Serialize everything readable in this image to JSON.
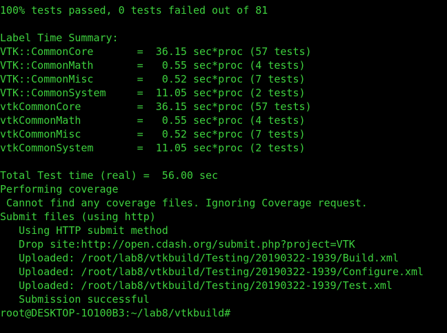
{
  "colors": {
    "background": "#000000",
    "text": "#3ed13e"
  },
  "terminal": {
    "lines": [
      "100% tests passed, 0 tests failed out of 81",
      "",
      "Label Time Summary:",
      "VTK::CommonCore       =  36.15 sec*proc (57 tests)",
      "VTK::CommonMath       =   0.55 sec*proc (4 tests)",
      "VTK::CommonMisc       =   0.52 sec*proc (7 tests)",
      "VTK::CommonSystem     =  11.05 sec*proc (2 tests)",
      "vtkCommonCore         =  36.15 sec*proc (57 tests)",
      "vtkCommonMath         =   0.55 sec*proc (4 tests)",
      "vtkCommonMisc         =   0.52 sec*proc (7 tests)",
      "vtkCommonSystem       =  11.05 sec*proc (2 tests)",
      "",
      "Total Test time (real) =  56.00 sec",
      "Performing coverage",
      " Cannot find any coverage files. Ignoring Coverage request.",
      "Submit files (using http)",
      "   Using HTTP submit method",
      "   Drop site:http://open.cdash.org/submit.php?project=VTK",
      "   Uploaded: /root/lab8/vtkbuild/Testing/20190322-1939/Build.xml",
      "   Uploaded: /root/lab8/vtkbuild/Testing/20190322-1939/Configure.xml",
      "   Uploaded: /root/lab8/vtkbuild/Testing/20190322-1939/Test.xml",
      "   Submission successful"
    ],
    "prompt": "root@DESKTOP-1O100B3:~/lab8/vtkbuild#"
  }
}
